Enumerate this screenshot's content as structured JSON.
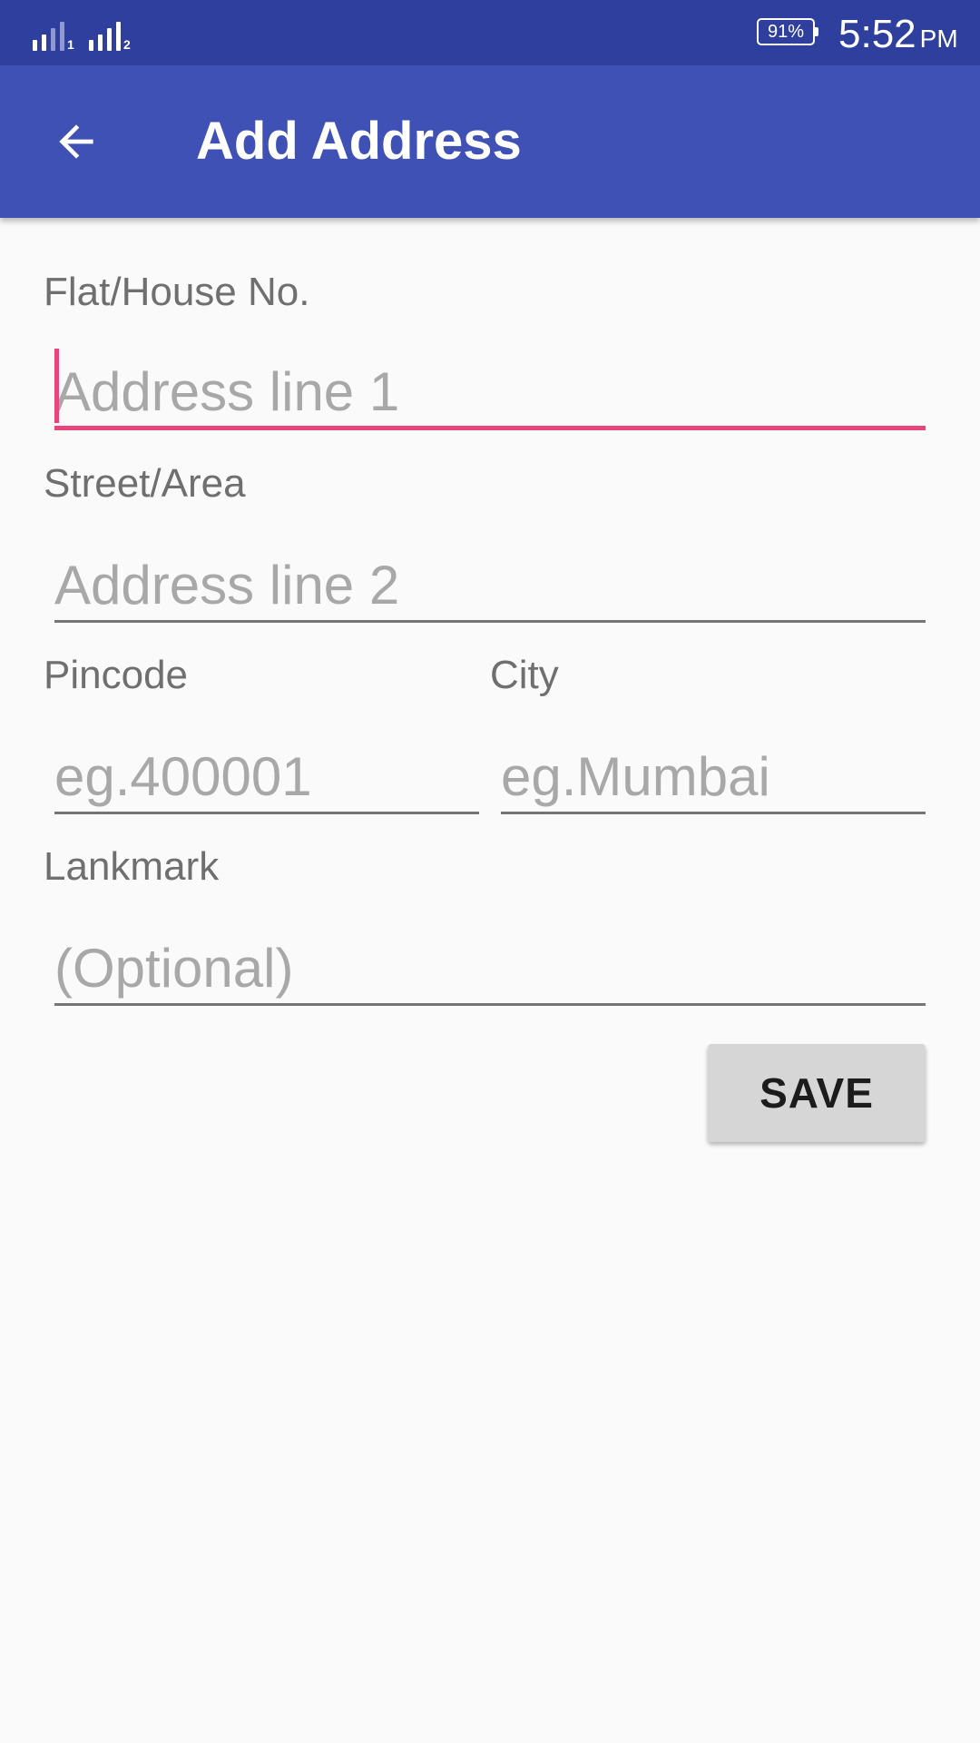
{
  "status_bar": {
    "sim1_label": "1",
    "sim2_label": "2",
    "battery": "91%",
    "time": "5:52",
    "ampm": "PM"
  },
  "app_bar": {
    "back_icon": "arrow-left-icon",
    "title": "Add Address",
    "background": "#3f51b5"
  },
  "form": {
    "flat": {
      "label": "Flat/House No.",
      "placeholder": "Address line 1",
      "value": ""
    },
    "street": {
      "label": "Street/Area",
      "placeholder": "Address line 2",
      "value": ""
    },
    "pincode": {
      "label": "Pincode",
      "placeholder": "eg.400001",
      "value": ""
    },
    "city": {
      "label": "City",
      "placeholder": "eg.Mumbai",
      "value": ""
    },
    "landmark": {
      "label": "Lankmark",
      "placeholder": "(Optional)",
      "value": ""
    },
    "accent_color": "#e8457d"
  },
  "actions": {
    "save_label": "SAVE"
  }
}
